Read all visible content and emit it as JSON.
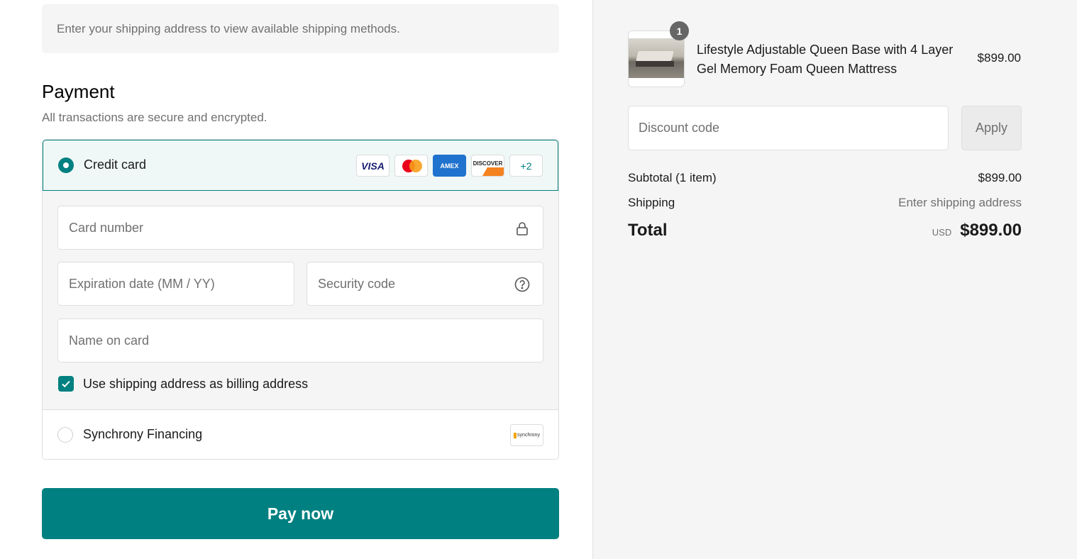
{
  "shipping_notice": "Enter your shipping address to view available shipping methods.",
  "payment": {
    "title": "Payment",
    "subtitle": "All transactions are secure and encrypted.",
    "credit_card_label": "Credit card",
    "card_logos": [
      "VISA",
      "MC",
      "AMEX",
      "DISCOVER",
      "+2"
    ],
    "fields": {
      "card_number": "Card number",
      "expiration": "Expiration date (MM / YY)",
      "security_code": "Security code",
      "name_on_card": "Name on card"
    },
    "billing_checkbox_label": "Use shipping address as billing address",
    "billing_checkbox_checked": true,
    "synchrony_label": "Synchrony Financing",
    "synchrony_logo_text": "synchrony",
    "pay_button": "Pay now"
  },
  "order": {
    "quantity": "1",
    "product_name": "Lifestyle Adjustable Queen Base with 4 Layer Gel Memory Foam Queen Mattress",
    "product_price": "$899.00",
    "discount_placeholder": "Discount code",
    "apply_label": "Apply",
    "subtotal_label": "Subtotal (1 item)",
    "subtotal_value": "$899.00",
    "shipping_label": "Shipping",
    "shipping_value": "Enter shipping address",
    "total_label": "Total",
    "total_currency": "USD",
    "total_value": "$899.00"
  },
  "colors": {
    "accent": "#008080",
    "panel_bg": "#f5f5f5"
  }
}
